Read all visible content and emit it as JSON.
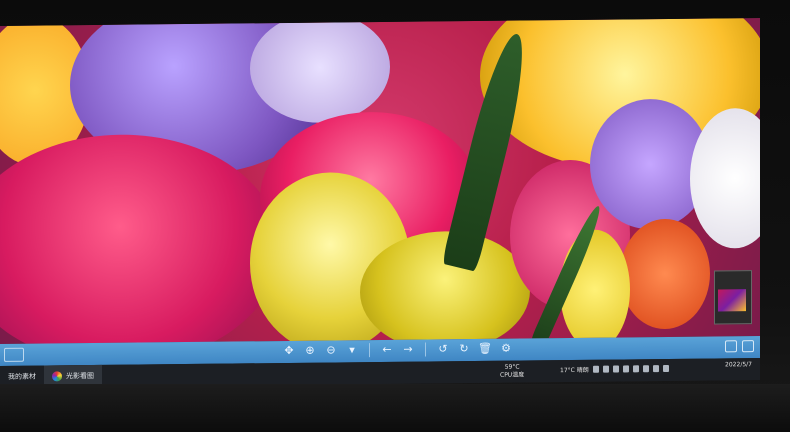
{
  "viewer": {
    "toolbar_buttons": [
      {
        "name": "fit-icon",
        "glyph": "✥"
      },
      {
        "name": "zoom-in-icon",
        "glyph": "⊕"
      },
      {
        "name": "zoom-out-icon",
        "glyph": "⊖"
      },
      {
        "name": "zoom-menu-icon",
        "glyph": "▾"
      },
      {
        "name": "prev-arrow-icon",
        "glyph": "←"
      },
      {
        "name": "next-arrow-icon",
        "glyph": "→"
      },
      {
        "name": "rotate-left-icon",
        "glyph": "↺"
      },
      {
        "name": "rotate-right-icon",
        "glyph": "↻"
      },
      {
        "name": "delete-icon",
        "glyph": "🗑"
      },
      {
        "name": "settings-icon",
        "glyph": "⚙"
      }
    ]
  },
  "taskbar": {
    "item1_label": "我的素材",
    "item2_label": "光影看图",
    "weather_temp": "59°C",
    "weather_label": "CPU温度",
    "tray_weather": "17°C 晴朗",
    "clock_time": "",
    "clock_date": "2022/5/7"
  },
  "colors": {
    "toolbar": "#4a94cf",
    "taskbar": "#1c1f24"
  }
}
